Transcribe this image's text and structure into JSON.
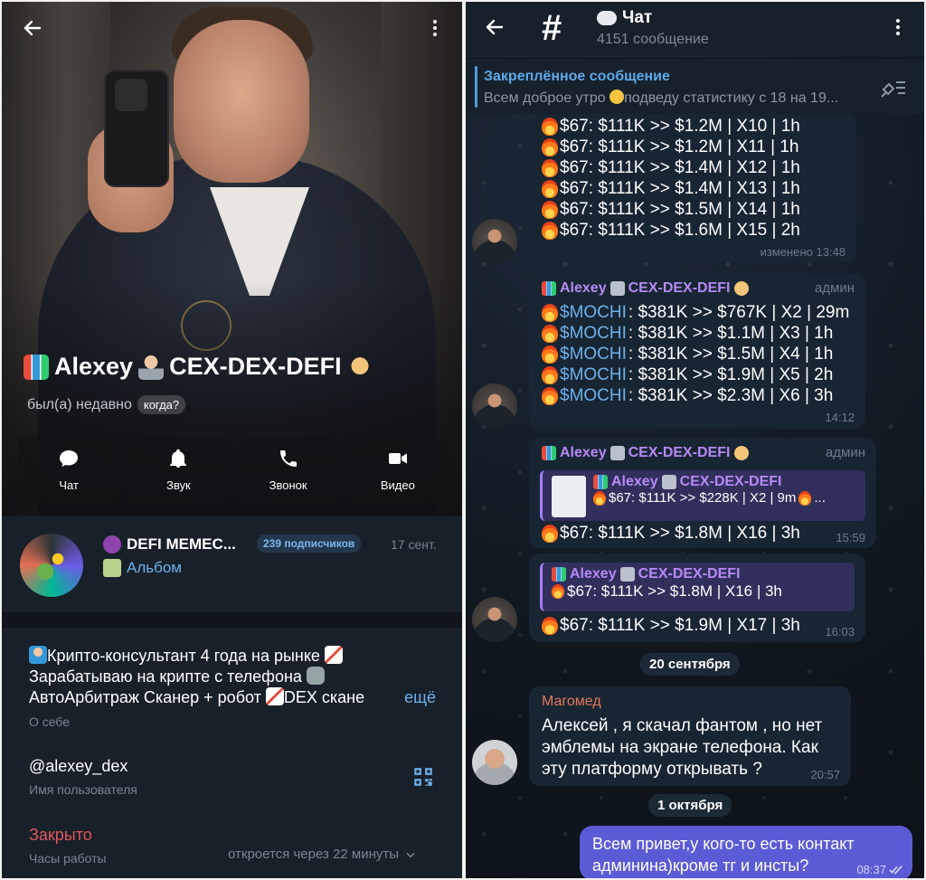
{
  "left": {
    "name": "Alexey",
    "name_suffix": "CEX-DEX-DEFI",
    "status": "был(а) недавно",
    "status_when": "когда?",
    "actions": [
      {
        "label": "Чат",
        "icon": "chat-icon"
      },
      {
        "label": "Звук",
        "icon": "bell-icon"
      },
      {
        "label": "Звонок",
        "icon": "phone-icon"
      },
      {
        "label": "Видео",
        "icon": "video-icon"
      }
    ],
    "channel": {
      "title": "DEFI MEMEC...",
      "subscribers": "239 подписчиков",
      "date": "17 сент.",
      "album": "Альбом"
    },
    "bio": {
      "line1": "Крипто-консультант 4 года на рынке",
      "line2": "Зарабатываю на крипте с телефона",
      "line3": "АвтоАрбитраж Сканер + робот",
      "line3_tail": "DEX скане",
      "more": "ещё",
      "label": "О себе"
    },
    "username": "@alexey_dex",
    "username_label": "Имя пользователя",
    "closed": "Закрыто",
    "hours_label": "Часы работы",
    "opens": "откроется через 22 минуты"
  },
  "right": {
    "chat_title": "Чат",
    "chat_sub": "4151 сообщение",
    "pinned_title": "Закреплённое сообщение",
    "pinned_text_a": "Всем доброе утро",
    "pinned_text_b": "подведу статистику с 18 на 19...",
    "msg1": {
      "lines": [
        "$67: $111K >> $1.2M | X10 | 1h",
        "$67: $111K >> $1.2M | X11 | 1h",
        "$67: $111K >> $1.4M | X12 | 1h",
        "$67: $111K >> $1.4M | X13 | 1h",
        "$67: $111K >> $1.5M | X14 | 1h",
        "$67: $111K >> $1.6M | X15 | 2h"
      ],
      "meta": "изменено 13:48"
    },
    "msg2": {
      "sender": "Alexey",
      "sender_suffix": "CEX-DEX-DEFI",
      "role": "админ",
      "ticker": "$MOCHI",
      "lines": [
        ": $381K >> $767K | X2 | 29m",
        ": $381K >> $1.1M | X3 | 1h",
        ": $381K >> $1.5M | X4 | 1h",
        ": $381K >> $1.9M | X5 | 2h",
        ": $381K >> $2.3M | X6 | 3h"
      ],
      "meta": "14:12"
    },
    "msg3": {
      "sender": "Alexey",
      "sender_suffix": "CEX-DEX-DEFI",
      "role": "админ",
      "reply_sender": "Alexey",
      "reply_suffix": "CEX-DEX-DEFI",
      "reply_text": "$67: $111K >> $228K | X2 | 9m",
      "line": "$67: $111K >> $1.8M | X16 | 3h",
      "meta": "15:59"
    },
    "msg4": {
      "reply_sender": "Alexey",
      "reply_suffix": "CEX-DEX-DEFI",
      "reply_text": "$67: $111K >> $1.8M | X16 | 3h",
      "line": "$67: $111K >> $1.9M | X17 | 3h",
      "meta": "16:03"
    },
    "date1": "20 сентября",
    "msg5": {
      "sender": "Магомед",
      "line1": "Алексей , я скачал фантом , но нет",
      "line2": "эмблемы на экране телефона. Как",
      "line3": "эту платформу открывать ?",
      "meta": "20:57"
    },
    "date2": "1 октября",
    "msg6": {
      "line1": "Всем привет,у кого-то есть контакт",
      "line2": "админина)кроме тг и инсты?",
      "meta": "08:37"
    }
  },
  "colors": {
    "accent": "#6fb1ea",
    "admin_name": "#b68af5",
    "closed": "#e0575a",
    "own_bubble": "#5c5bd6"
  }
}
